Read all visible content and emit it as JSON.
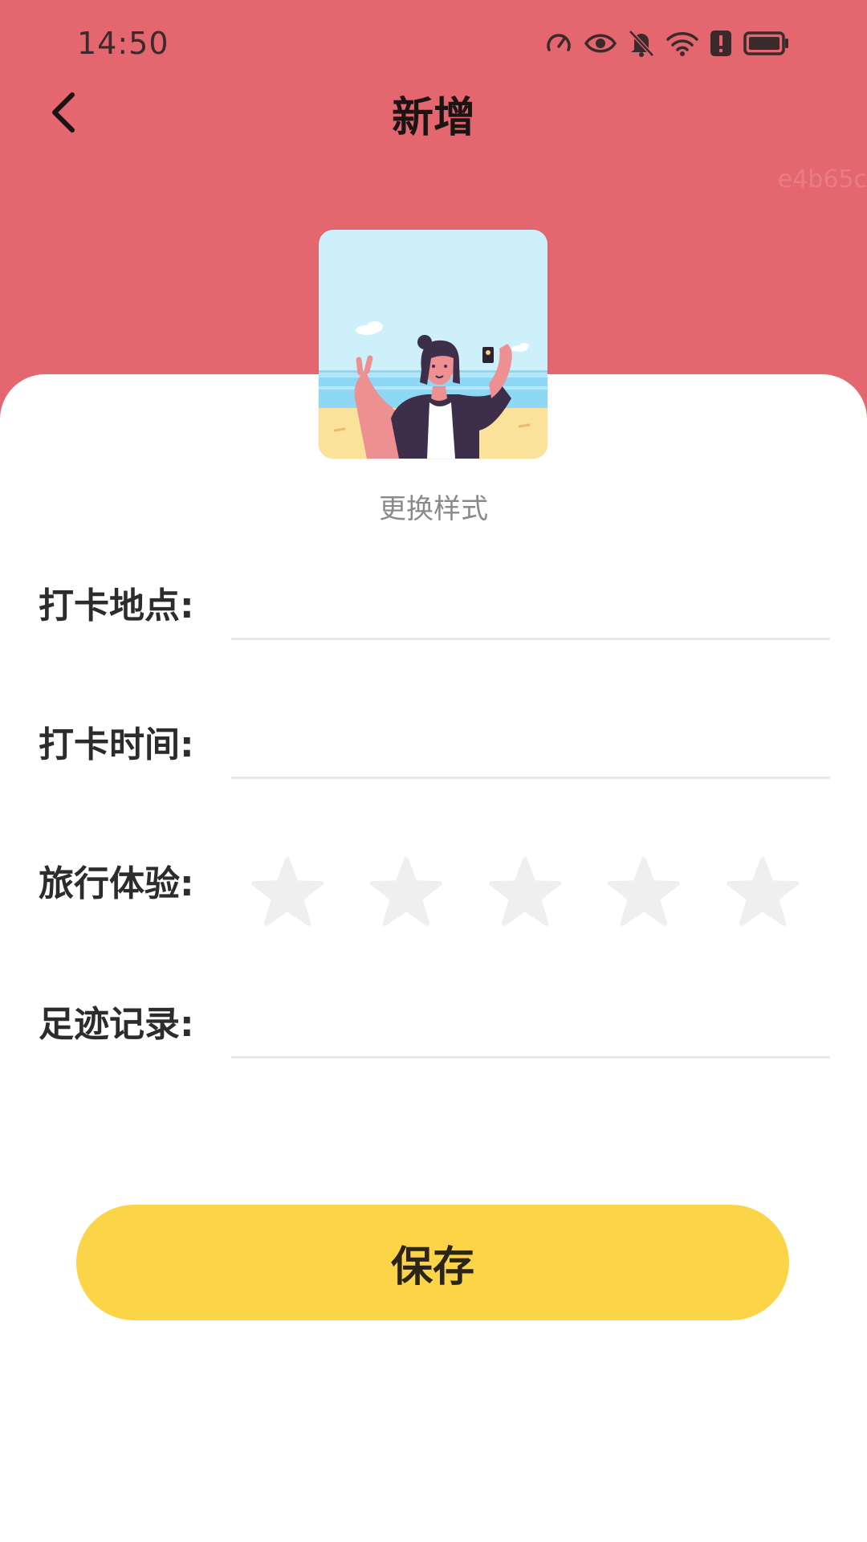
{
  "status_bar": {
    "time": "14:50",
    "icons": [
      "speedometer-icon",
      "eye-icon",
      "bell-off-icon",
      "wifi-icon",
      "alert-icon",
      "battery-icon"
    ]
  },
  "header": {
    "title": "新增",
    "back_icon": "back-arrow-icon",
    "watermark": "e4b65c",
    "background_color": "#e4666f"
  },
  "cover": {
    "image": "selfie-beach-illustration",
    "change_label": "更换样式"
  },
  "form": {
    "location": {
      "label": "打卡地点:",
      "value": "",
      "placeholder": ""
    },
    "time": {
      "label": "打卡时间:",
      "value": "",
      "placeholder": ""
    },
    "rating": {
      "label": "旅行体验:",
      "value": 0,
      "max": 5
    },
    "notes": {
      "label": "足迹记录:",
      "value": "",
      "placeholder": ""
    }
  },
  "actions": {
    "save_label": "保存",
    "save_color": "#fcd448"
  }
}
